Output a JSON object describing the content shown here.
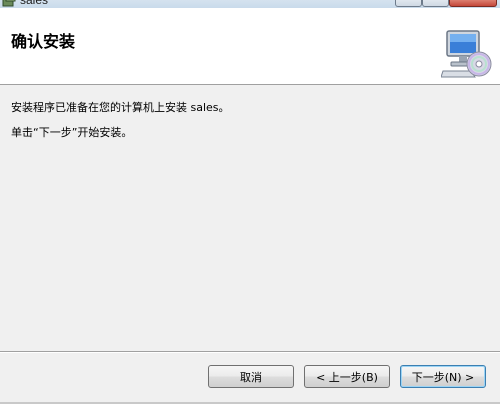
{
  "window": {
    "title": "sales"
  },
  "header": {
    "title": "确认安装",
    "icon": "computer-disc-icon"
  },
  "body": {
    "line1": "安装程序已准备在您的计算机上安装 sales。",
    "line2": "单击“下一步”开始安装。"
  },
  "buttons": {
    "cancel": "取消",
    "back": "< 上一步(B)",
    "next": "下一步(N) >"
  }
}
